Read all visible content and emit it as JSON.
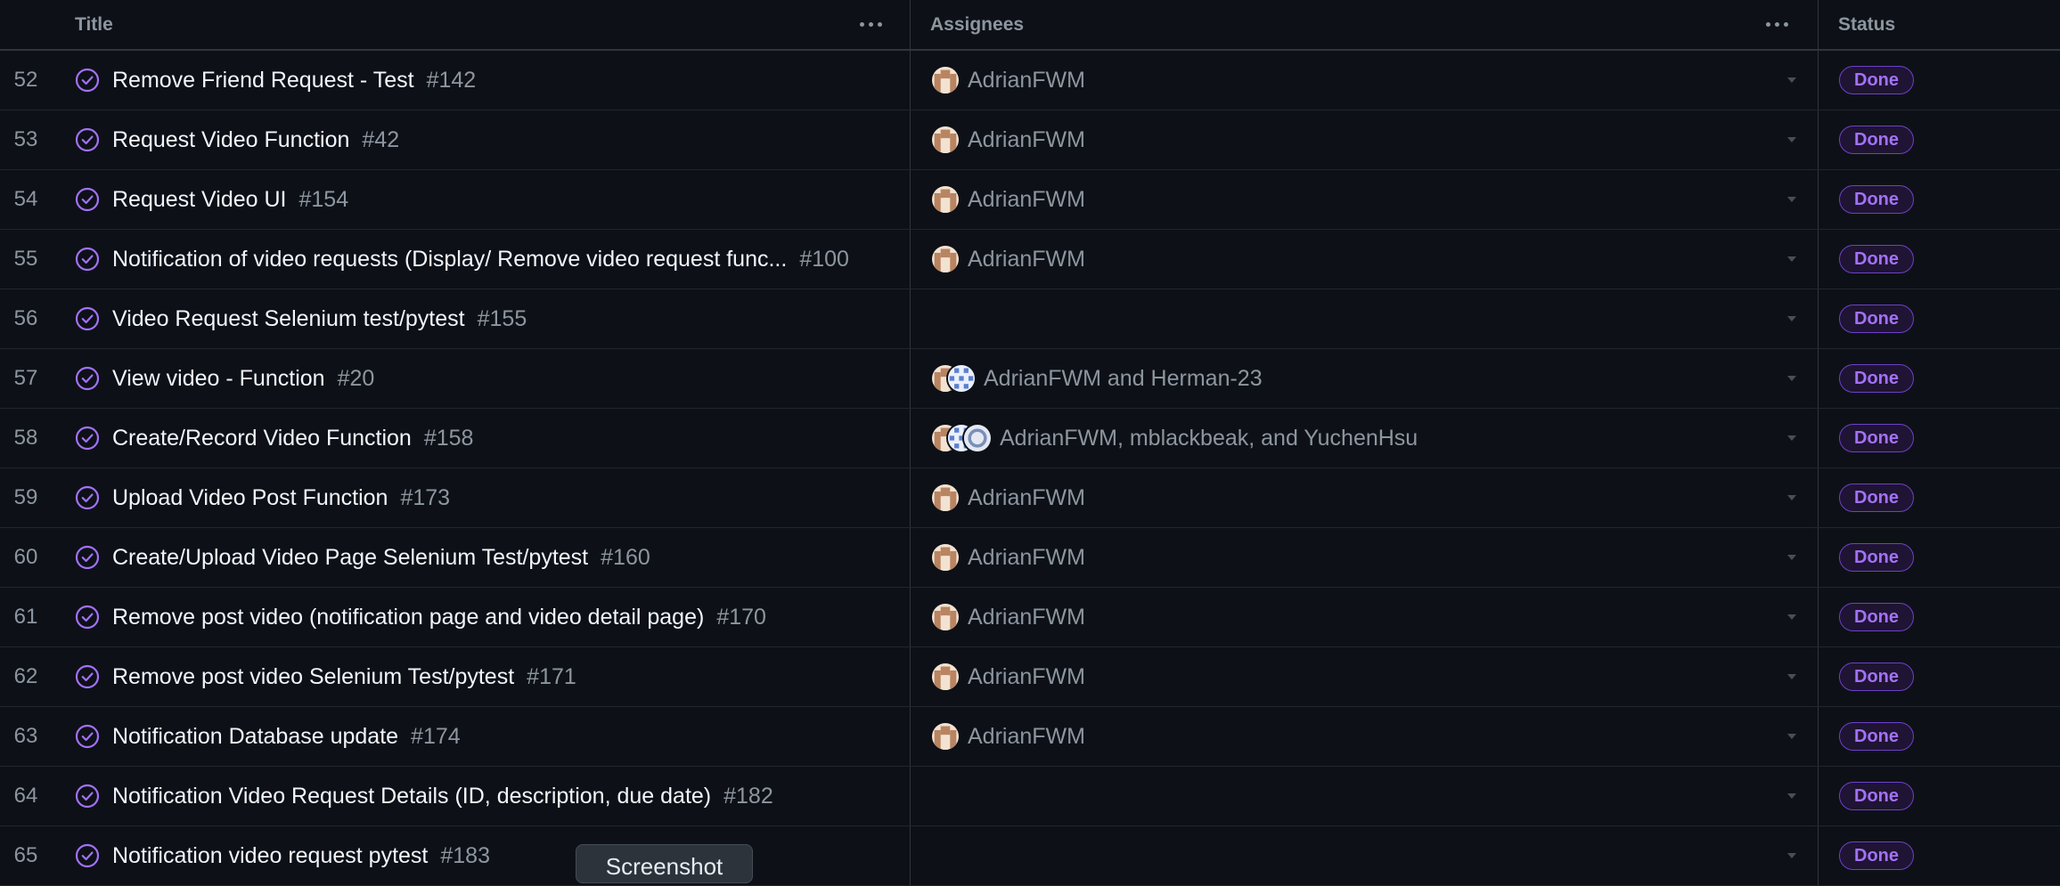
{
  "columns": {
    "title": "Title",
    "assignees": "Assignees",
    "status": "Status"
  },
  "colors": {
    "background": "#0d1117",
    "done_accent": "#a371f7",
    "icon_done": "#a371f7"
  },
  "rows": [
    {
      "num": "52",
      "title": "Remove Friend Request - Test",
      "issue": "#142",
      "assignees": "AdrianFWM",
      "avatars": [
        "adrian"
      ],
      "status": "Done"
    },
    {
      "num": "53",
      "title": "Request Video Function",
      "issue": "#42",
      "assignees": "AdrianFWM",
      "avatars": [
        "adrian"
      ],
      "status": "Done"
    },
    {
      "num": "54",
      "title": "Request Video UI",
      "issue": "#154",
      "assignees": "AdrianFWM",
      "avatars": [
        "adrian"
      ],
      "status": "Done"
    },
    {
      "num": "55",
      "title": "Notification of video requests (Display/ Remove video request func...",
      "issue": "#100",
      "assignees": "AdrianFWM",
      "avatars": [
        "adrian"
      ],
      "status": "Done"
    },
    {
      "num": "56",
      "title": "Video Request Selenium test/pytest",
      "issue": "#155",
      "assignees": "",
      "avatars": [],
      "status": "Done"
    },
    {
      "num": "57",
      "title": "View video - Function",
      "issue": "#20",
      "assignees": "AdrianFWM and Herman-23",
      "avatars": [
        "adrian",
        "herman"
      ],
      "status": "Done"
    },
    {
      "num": "58",
      "title": "Create/Record Video Function",
      "issue": "#158",
      "assignees": "AdrianFWM, mblackbeak, and YuchenHsu",
      "avatars": [
        "adrian",
        "herman",
        "yuchen"
      ],
      "status": "Done"
    },
    {
      "num": "59",
      "title": "Upload Video Post Function",
      "issue": "#173",
      "assignees": "AdrianFWM",
      "avatars": [
        "adrian"
      ],
      "status": "Done"
    },
    {
      "num": "60",
      "title": "Create/Upload Video Page Selenium Test/pytest",
      "issue": "#160",
      "assignees": "AdrianFWM",
      "avatars": [
        "adrian"
      ],
      "status": "Done"
    },
    {
      "num": "61",
      "title": "Remove post video (notification page and video detail page)",
      "issue": "#170",
      "assignees": "AdrianFWM",
      "avatars": [
        "adrian"
      ],
      "status": "Done"
    },
    {
      "num": "62",
      "title": "Remove post video Selenium Test/pytest",
      "issue": "#171",
      "assignees": "AdrianFWM",
      "avatars": [
        "adrian"
      ],
      "status": "Done"
    },
    {
      "num": "63",
      "title": "Notification Database update",
      "issue": "#174",
      "assignees": "AdrianFWM",
      "avatars": [
        "adrian"
      ],
      "status": "Done"
    },
    {
      "num": "64",
      "title": "Notification Video Request Details (ID, description, due date)",
      "issue": "#182",
      "assignees": "",
      "avatars": [],
      "status": "Done"
    },
    {
      "num": "65",
      "title": "Notification video request pytest",
      "issue": "#183",
      "assignees": "",
      "avatars": [],
      "status": "Done"
    }
  ],
  "tooltip": "Screenshot"
}
